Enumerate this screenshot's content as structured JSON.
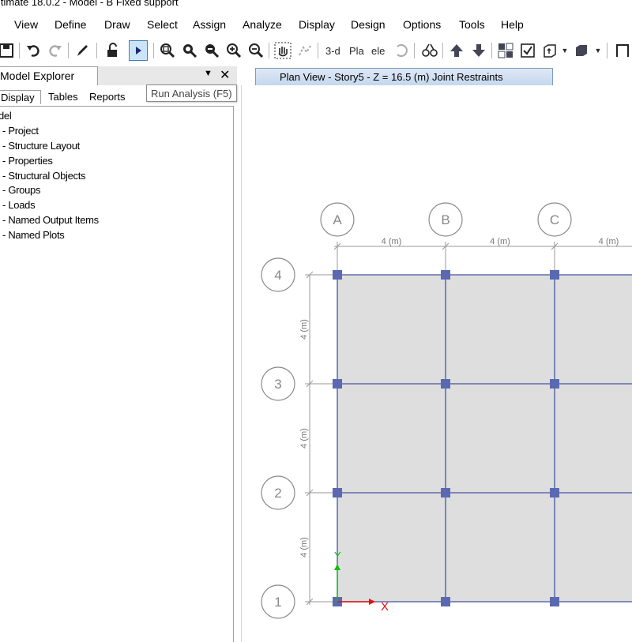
{
  "window": {
    "title": "ltimate 18.0.2 - Model - B Fixed support"
  },
  "menu": [
    "View",
    "Define",
    "Draw",
    "Select",
    "Assign",
    "Analyze",
    "Display",
    "Design",
    "Options",
    "Tools",
    "Help"
  ],
  "toolbar": {
    "labels": {
      "three_d": "3-d",
      "plan": "Pla",
      "elev": "ele"
    },
    "active": "run-analysis-button"
  },
  "tooltip": {
    "text": "Run Analysis (F5)"
  },
  "explorer": {
    "title": "Model Explorer",
    "close": "✕",
    "tabs": [
      "Display",
      "Tables",
      "Reports"
    ],
    "root": "del",
    "items": [
      "Project",
      "Structure Layout",
      "Properties",
      "Structural Objects",
      "Groups",
      "Loads",
      "Named Output Items",
      "Named Plots"
    ]
  },
  "view_tab": {
    "title": "Plan View - Story5 - Z = 16.5 (m)  Joint Restraints"
  },
  "plan": {
    "grid_x": [
      "A",
      "B",
      "C"
    ],
    "grid_y": [
      "4",
      "3",
      "2",
      "1"
    ],
    "dim_x": [
      "4 (m)",
      "4 (m)",
      "4 (m)"
    ],
    "dim_y": [
      "4 (m)",
      "4 (m)",
      "4 (m)"
    ],
    "axis_x": "X",
    "axis_y": "Y",
    "colors": {
      "grid": "#4553a0",
      "slab": "#dedede",
      "joint": "#5b6ab0",
      "bubble": "#8a8a8a",
      "x_axis": "#e01010",
      "y_axis": "#10c010"
    }
  }
}
